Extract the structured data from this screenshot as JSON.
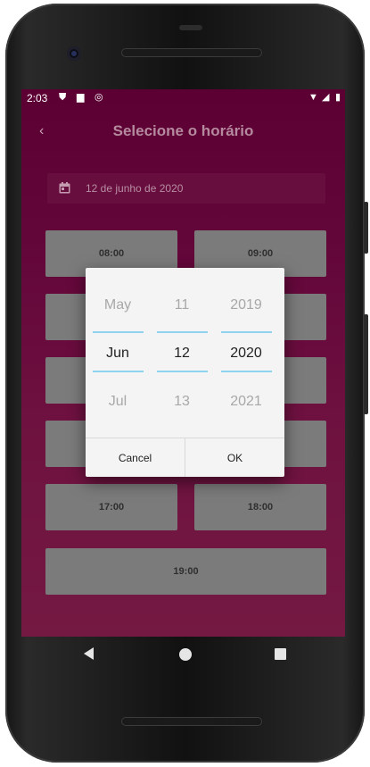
{
  "status": {
    "time": "2:03",
    "icons": [
      "shield-icon",
      "sd-card-icon",
      "sync-icon",
      "wifi-icon",
      "cell-signal-icon",
      "battery-icon"
    ]
  },
  "appbar": {
    "back_icon": "chevron-left-icon",
    "title": "Selecione o horário"
  },
  "date_field": {
    "icon": "calendar-icon",
    "value": "12 de junho de 2020"
  },
  "slots": [
    "08:00",
    "09:00",
    "17:00",
    "18:00",
    "19:00"
  ],
  "date_picker": {
    "month": {
      "prev": "May",
      "selected": "Jun",
      "next": "Jul"
    },
    "day": {
      "prev": "11",
      "selected": "12",
      "next": "13"
    },
    "year": {
      "prev": "2019",
      "selected": "2020",
      "next": "2021"
    },
    "cancel_label": "Cancel",
    "ok_label": "OK"
  },
  "navbar": {
    "icons": [
      "back-triangle-icon",
      "home-circle-icon",
      "recents-square-icon"
    ]
  },
  "colors": {
    "screen_bg": "#5c0034",
    "accent_divider": "#8fd4ee",
    "slot_bg": "#7b7b7b",
    "dialog_bg": "#f4f4f4"
  }
}
